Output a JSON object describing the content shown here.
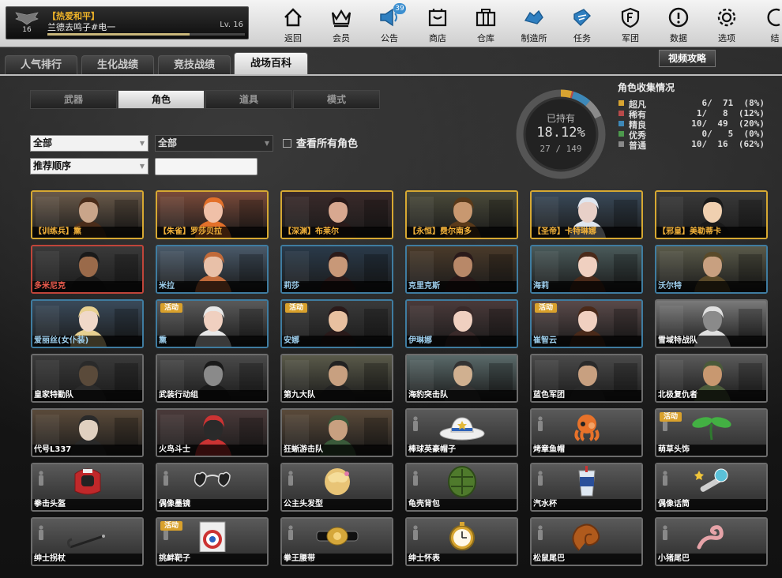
{
  "player": {
    "clan": "【热爱和平】",
    "name": "兰德去鸣子#电一",
    "level": "Lv. 16",
    "rank": "16",
    "exp_fraction": 0.72
  },
  "nav": [
    {
      "label": "返回",
      "icon": "home-icon"
    },
    {
      "label": "会员",
      "icon": "crown-icon"
    },
    {
      "label": "公告",
      "icon": "megaphone-icon",
      "badge": "39"
    },
    {
      "label": "商店",
      "icon": "shop-icon"
    },
    {
      "label": "仓库",
      "icon": "warehouse-icon"
    },
    {
      "label": "制造所",
      "icon": "factory-icon"
    },
    {
      "label": "任务",
      "icon": "mission-icon"
    },
    {
      "label": "军团",
      "icon": "legion-icon"
    },
    {
      "label": "数据",
      "icon": "info-icon"
    },
    {
      "label": "选项",
      "icon": "gear-icon"
    },
    {
      "label": "结",
      "icon": "exit-icon"
    }
  ],
  "tabs": [
    "人气排行",
    "生化战绩",
    "竞技战绩",
    "战场百科"
  ],
  "video_label": "视频攻略",
  "sub_tabs": [
    "武器",
    "角色",
    "道具",
    "模式"
  ],
  "filters": {
    "category": "全部",
    "type": "全部",
    "sort": "推荐顺序",
    "search_value": "",
    "view_all_label": "查看所有角色"
  },
  "collection": {
    "title": "角色收集情况",
    "owned_label": "已持有",
    "owned_pct": "18.12%",
    "owned_count": "27 / 149",
    "owned_fraction": 0.1812
  },
  "stats": [
    {
      "name": "超凡",
      "count": " 6/  71",
      "pct": "(8%)",
      "color": "#d8a431",
      "fraction": 0.0403
    },
    {
      "name": "稀有",
      "count": " 1/   8",
      "pct": "(12%)",
      "color": "#b84a4a",
      "fraction": 0.0067
    },
    {
      "name": "精良",
      "count": "10/  49",
      "pct": "(20%)",
      "color": "#3d88b8",
      "fraction": 0.0671
    },
    {
      "name": "优秀",
      "count": " 0/   5",
      "pct": "(0%)",
      "color": "#4d9a4d",
      "fraction": 0
    },
    {
      "name": "普通",
      "count": "10/  16",
      "pct": "(62%)",
      "color": "#8a8a8a",
      "fraction": 0.0671
    }
  ],
  "cards": [
    {
      "label": "【训练兵】熏",
      "rarity": "gold",
      "kind": "char"
    },
    {
      "label": "【朱雀】罗莎贝拉",
      "rarity": "gold",
      "kind": "char"
    },
    {
      "label": "【深渊】布莱尔",
      "rarity": "gold",
      "kind": "char"
    },
    {
      "label": "【永恒】费尔南多",
      "rarity": "gold",
      "kind": "char"
    },
    {
      "label": "【圣帝】卡特琳娜",
      "rarity": "gold",
      "kind": "char"
    },
    {
      "label": "【邪皇】美勒蒂卡",
      "rarity": "gold",
      "kind": "char"
    },
    {
      "label": "多米尼克",
      "rarity": "red",
      "kind": "char"
    },
    {
      "label": "米拉",
      "rarity": "blue",
      "kind": "char"
    },
    {
      "label": "莉莎",
      "rarity": "blue",
      "kind": "char"
    },
    {
      "label": "克里克斯",
      "rarity": "blue",
      "kind": "char"
    },
    {
      "label": "海莉",
      "rarity": "blue",
      "kind": "char"
    },
    {
      "label": "沃尔特",
      "rarity": "blue",
      "kind": "char"
    },
    {
      "label": "爱丽丝(女仆装)",
      "rarity": "blue",
      "kind": "char"
    },
    {
      "label": "熏",
      "rarity": "blue",
      "kind": "char",
      "event": "活动"
    },
    {
      "label": "安娜",
      "rarity": "blue",
      "kind": "char",
      "event": "活动"
    },
    {
      "label": "伊琳娜",
      "rarity": "blue",
      "kind": "char"
    },
    {
      "label": "崔智云",
      "rarity": "blue",
      "kind": "char",
      "event": "活动"
    },
    {
      "label": "雪域特战队",
      "rarity": "gray",
      "kind": "char"
    },
    {
      "label": "皇家特勤队",
      "rarity": "gray",
      "kind": "char"
    },
    {
      "label": "武装行动组",
      "rarity": "gray",
      "kind": "char"
    },
    {
      "label": "第九大队",
      "rarity": "gray",
      "kind": "char"
    },
    {
      "label": "海豹突击队",
      "rarity": "gray",
      "kind": "char"
    },
    {
      "label": "蓝色军团",
      "rarity": "gray",
      "kind": "char"
    },
    {
      "label": "北极复仇者",
      "rarity": "gray",
      "kind": "char"
    },
    {
      "label": "代号L337",
      "rarity": "gray",
      "kind": "char"
    },
    {
      "label": "火鸟斗士",
      "rarity": "gray",
      "kind": "char"
    },
    {
      "label": "狂蜥游击队",
      "rarity": "gray",
      "kind": "char"
    },
    {
      "label": "棒球英豪帽子",
      "rarity": "gray",
      "kind": "item",
      "icon": "cowboy-hat-icon"
    },
    {
      "label": "烤章鱼帽",
      "rarity": "gray",
      "kind": "item",
      "icon": "octopus-hat-icon"
    },
    {
      "label": "萌草头饰",
      "rarity": "gray",
      "kind": "item",
      "icon": "sprout-icon",
      "event": "活动"
    },
    {
      "label": "拳击头盔",
      "rarity": "gray",
      "kind": "item",
      "icon": "boxing-helmet-icon"
    },
    {
      "label": "偶像墨镜",
      "rarity": "gray",
      "kind": "item",
      "icon": "heart-sunglasses-icon"
    },
    {
      "label": "公主头发型",
      "rarity": "gray",
      "kind": "item",
      "icon": "princess-hair-icon"
    },
    {
      "label": "龟壳背包",
      "rarity": "gray",
      "kind": "item",
      "icon": "turtle-shell-icon"
    },
    {
      "label": "汽水杯",
      "rarity": "gray",
      "kind": "item",
      "icon": "soda-cup-icon"
    },
    {
      "label": "偶像话筒",
      "rarity": "gray",
      "kind": "item",
      "icon": "microphone-icon"
    },
    {
      "label": "绅士拐杖",
      "rarity": "gray",
      "kind": "item",
      "icon": "cane-icon"
    },
    {
      "label": "挑衅靶子",
      "rarity": "gray",
      "kind": "item",
      "icon": "target-icon",
      "event": "活动"
    },
    {
      "label": "拳王腰带",
      "rarity": "gray",
      "kind": "item",
      "icon": "champion-belt-icon"
    },
    {
      "label": "绅士怀表",
      "rarity": "gray",
      "kind": "item",
      "icon": "pocket-watch-icon"
    },
    {
      "label": "松鼠尾巴",
      "rarity": "gray",
      "kind": "item",
      "icon": "squirrel-tail-icon"
    },
    {
      "label": "小猪尾巴",
      "rarity": "gray",
      "kind": "item",
      "icon": "pig-tail-icon"
    }
  ]
}
